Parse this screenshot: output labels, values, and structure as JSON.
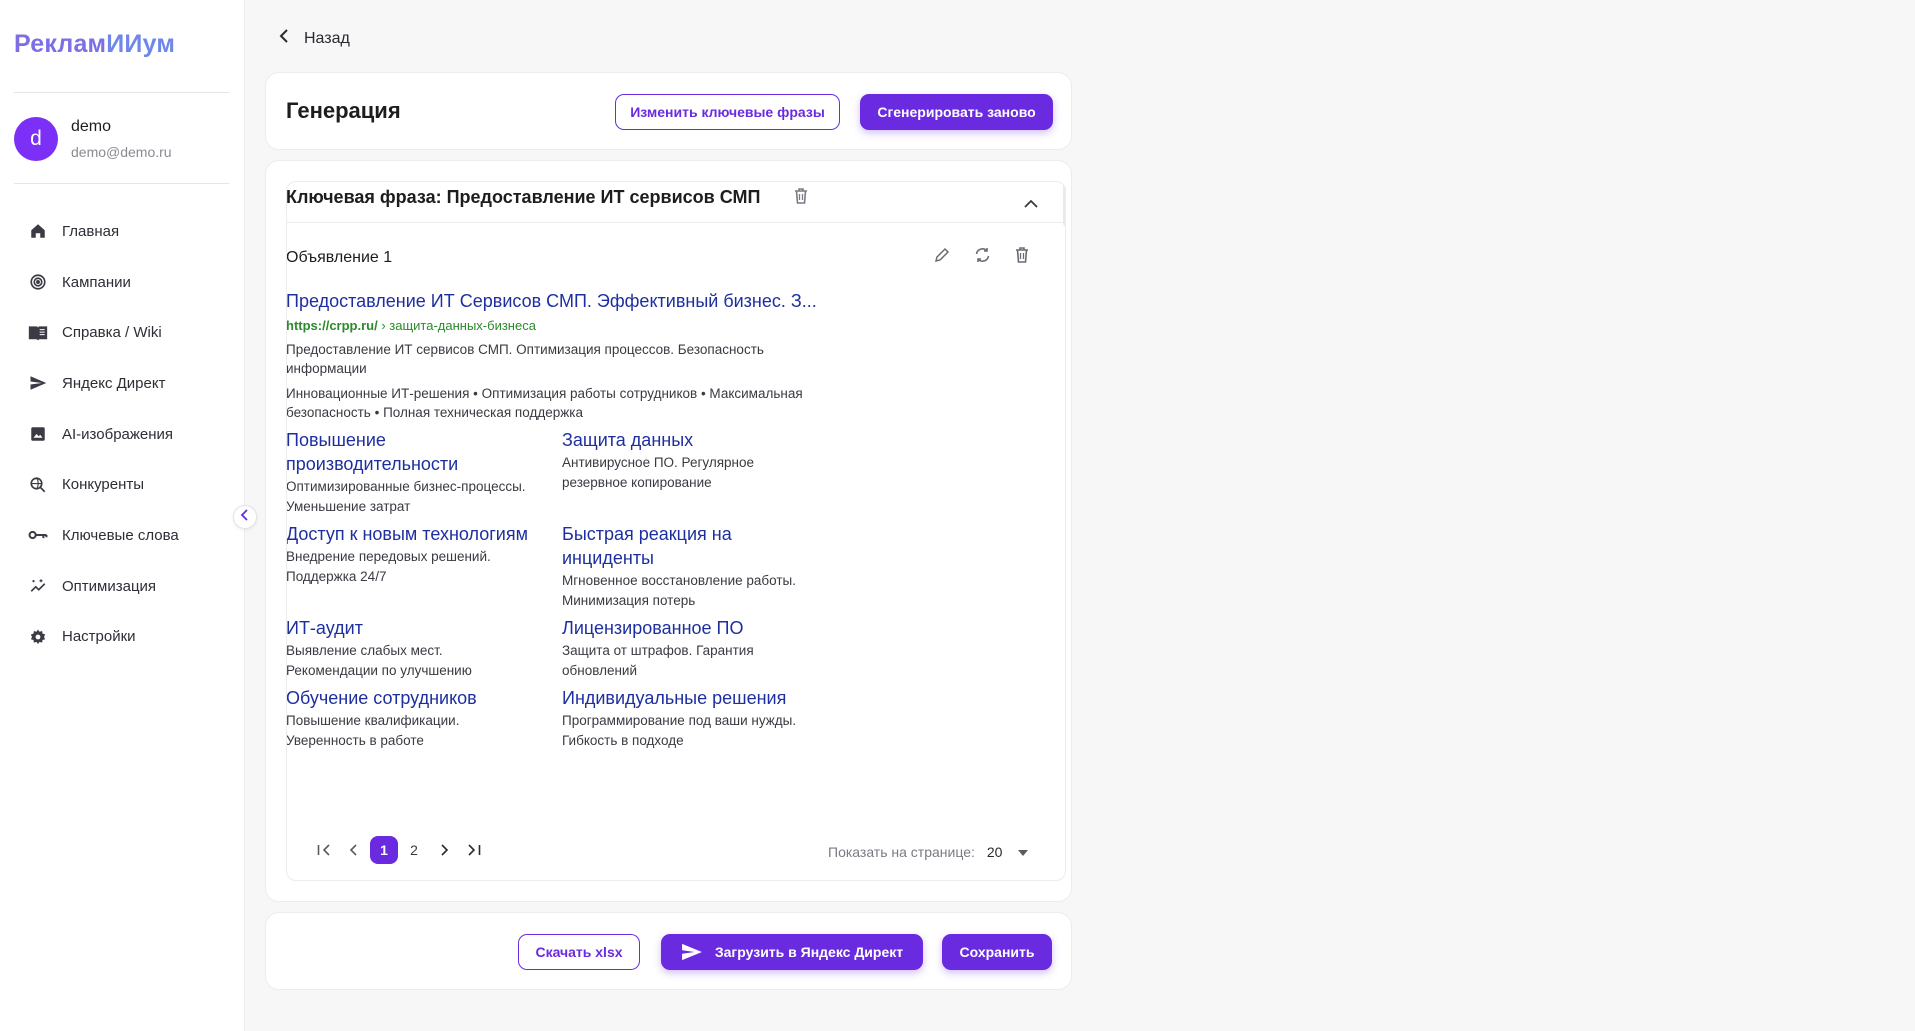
{
  "app": {
    "logo_a": "Реклам",
    "logo_b": "ИИум"
  },
  "user": {
    "initial": "d",
    "name": "demo",
    "email": "demo@demo.ru"
  },
  "nav": [
    {
      "label": "Главная",
      "icon": "home-icon"
    },
    {
      "label": "Кампании",
      "icon": "target-icon"
    },
    {
      "label": "Справка / Wiki",
      "icon": "book-icon"
    },
    {
      "label": "Яндекс Директ",
      "icon": "send-icon"
    },
    {
      "label": "AI-изображения",
      "icon": "image-icon"
    },
    {
      "label": "Конкуренты",
      "icon": "search-globe-icon"
    },
    {
      "label": "Ключевые слова",
      "icon": "key-icon"
    },
    {
      "label": "Оптимизация",
      "icon": "sparkle-chart-icon"
    },
    {
      "label": "Настройки",
      "icon": "gear-icon"
    }
  ],
  "back_label": "Назад",
  "header": {
    "title": "Генерация",
    "edit_keywords_label": "Изменить ключевые фразы",
    "regenerate_label": "Сгенерировать заново"
  },
  "keyphrase": {
    "title": "Ключевая фраза: Предоставление ИТ сервисов СМП"
  },
  "ad": {
    "label": "Объявление 1",
    "title": "Предоставление ИТ Сервисов СМП. Эффективный бизнес. З...",
    "url_domain": "https://crpp.ru/",
    "url_path": " › защита-данных-бизнеса",
    "text1_line1": "Предоставление ИТ сервисов СМП. Оптимизация процессов. Безопасность",
    "text1_line2": "информации",
    "text2_line1": "Инновационные ИТ-решения • Оптимизация работы сотрудников • Максимальная",
    "text2_line2": "безопасность • Полная техническая поддержка",
    "sitelinks": [
      {
        "t1": "Повышение",
        "t2": "производительности",
        "d1": "Оптимизированные бизнес-процессы.",
        "d2": "Уменьшение затрат"
      },
      {
        "t1": "Защита данных",
        "t2": "",
        "d1": "Антивирусное ПО. Регулярное",
        "d2": "резервное копирование"
      },
      {
        "t1": "Доступ к новым технологиям",
        "t2": "",
        "d1": "Внедрение передовых решений.",
        "d2": "Поддержка 24/7"
      },
      {
        "t1": "Быстрая реакция на",
        "t2": "инциденты",
        "d1": "Мгновенное восстановление работы.",
        "d2": "Минимизация потерь"
      },
      {
        "t1": "ИТ-аудит",
        "t2": "",
        "d1": "Выявление слабых мест.",
        "d2": "Рекомендации по улучшению"
      },
      {
        "t1": "Лицензированное ПО",
        "t2": "",
        "d1": "Защита от штрафов. Гарантия",
        "d2": "обновлений"
      },
      {
        "t1": "Обучение сотрудников",
        "t2": "",
        "d1": "Повышение квалификации.",
        "d2": "Уверенность в работе"
      },
      {
        "t1": "Индивидуальные решения",
        "t2": "",
        "d1": "Программирование под ваши нужды.",
        "d2": "Гибкость в подходе"
      }
    ]
  },
  "pagination": {
    "pages": [
      "1",
      "2"
    ],
    "current": "1",
    "per_page_label": "Показать на странице:",
    "per_page_value": "20"
  },
  "footer": {
    "download_label": "Скачать xlsx",
    "upload_label": "Загрузить в Яндекс Директ",
    "save_label": "Сохранить"
  },
  "colors": {
    "accent": "#6a2be0",
    "link": "#1d2fa0",
    "url": "#2b8a2b"
  }
}
